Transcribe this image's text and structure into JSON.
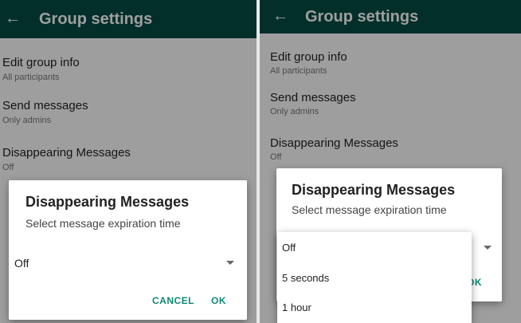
{
  "screens": [
    {
      "app_bar": {
        "back_icon": "arrow-left-icon",
        "title": "Group settings"
      },
      "settings": [
        {
          "title": "Edit group info",
          "subtitle": "All participants"
        },
        {
          "title": "Send messages",
          "subtitle": "Only admins"
        },
        {
          "title": "Disappearing Messages",
          "subtitle": "Off"
        }
      ],
      "dialog": {
        "title": "Disappearing Messages",
        "subtitle": "Select message expiration time",
        "selected": "Off",
        "cancel_label": "CANCEL",
        "ok_label": "OK"
      }
    },
    {
      "app_bar": {
        "back_icon": "arrow-left-icon",
        "title": "Group settings"
      },
      "settings": [
        {
          "title": "Edit group info",
          "subtitle": "All participants"
        },
        {
          "title": "Send messages",
          "subtitle": "Only admins"
        },
        {
          "title": "Disappearing Messages",
          "subtitle": "Off"
        }
      ],
      "dialog": {
        "title": "Disappearing Messages",
        "subtitle": "Select message expiration time",
        "ok_label": "OK",
        "options": [
          "Off",
          "5 seconds",
          "1 hour"
        ]
      }
    }
  ],
  "colors": {
    "app_bar": "#054d44",
    "accent": "#0d8a76"
  }
}
